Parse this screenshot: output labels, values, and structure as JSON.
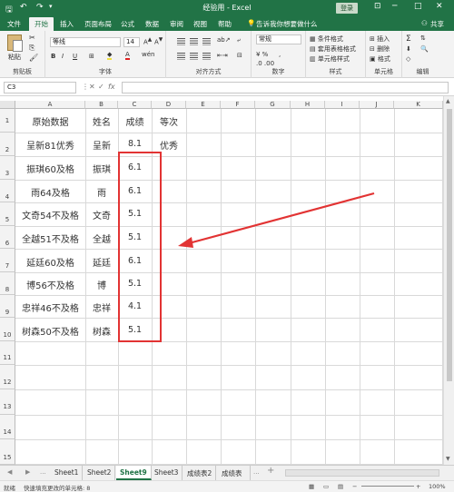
{
  "titlebar": {
    "save_icon": "save-icon",
    "undo_icon": "undo-icon",
    "redo_icon": "redo-icon",
    "title": "经验用 - Excel",
    "login_label": "登录",
    "minimize": "─",
    "restore": "□",
    "close": "✕",
    "ribbon_display": "⊡"
  },
  "menu": {
    "items": [
      "文件",
      "开始",
      "插入",
      "页面布局",
      "公式",
      "数据",
      "审阅",
      "视图",
      "帮助"
    ],
    "active": "开始",
    "tell_me": "告诉我你想要做什么",
    "share": "共享"
  },
  "ribbon": {
    "paste": "粘贴",
    "clipboard": "剪贴板",
    "font_name": "等线",
    "font_size": "14",
    "font_group": "字体",
    "align_group": "对齐方式",
    "number_format": "常规",
    "number_group": "数字",
    "cond_format": "条件格式",
    "table_format": "套用表格格式",
    "cell_style": "单元格样式",
    "style_group": "样式",
    "insert": "插入",
    "delete": "删除",
    "format": "格式",
    "cells_group": "单元格",
    "editing_group": "编辑",
    "bold": "B",
    "italic": "I",
    "underline": "U",
    "font_a": "A",
    "sum": "Σ"
  },
  "formula_bar": {
    "name_box": "C3",
    "fx": "fx",
    "cancel": "✕",
    "enter": "✓",
    "value": ""
  },
  "columns": [
    "A",
    "B",
    "C",
    "D",
    "E",
    "F",
    "G",
    "H",
    "I",
    "J",
    "K"
  ],
  "rows": [
    "1",
    "2",
    "3",
    "4",
    "5",
    "6",
    "7",
    "8",
    "9",
    "10",
    "11",
    "12",
    "13",
    "14",
    "15"
  ],
  "sheet": {
    "header": [
      "原始数据",
      "姓名",
      "成绩",
      "等次"
    ],
    "data": [
      [
        "呈新81优秀",
        "呈新",
        "8.1",
        "优秀"
      ],
      [
        "振琪60及格",
        "振琪",
        "6.1",
        ""
      ],
      [
        "雨64及格",
        "雨",
        "6.1",
        ""
      ],
      [
        "文奇54不及格",
        "文奇",
        "5.1",
        ""
      ],
      [
        "全越51不及格",
        "全越",
        "5.1",
        ""
      ],
      [
        "延廷60及格",
        "延廷",
        "6.1",
        ""
      ],
      [
        "博56不及格",
        "博",
        "5.1",
        ""
      ],
      [
        "忠祥46不及格",
        "忠祥",
        "4.1",
        ""
      ],
      [
        "树森50不及格",
        "树森",
        "5.1",
        ""
      ]
    ]
  },
  "annotation": {
    "box_color": "#e23333",
    "arrow_color": "#e23333"
  },
  "tabs": {
    "items": [
      "Sheet1",
      "Sheet2",
      "Sheet9",
      "Sheet3",
      "成绩表2",
      "成绩表"
    ],
    "active": "Sheet9",
    "more": "...",
    "add": "+"
  },
  "status": {
    "ready": "就绪",
    "message": "快速填充更改的单元格: 8",
    "zoom": "100%"
  },
  "colors": {
    "excel_green": "#217346",
    "ribbon_bg": "#f3f3f3"
  }
}
